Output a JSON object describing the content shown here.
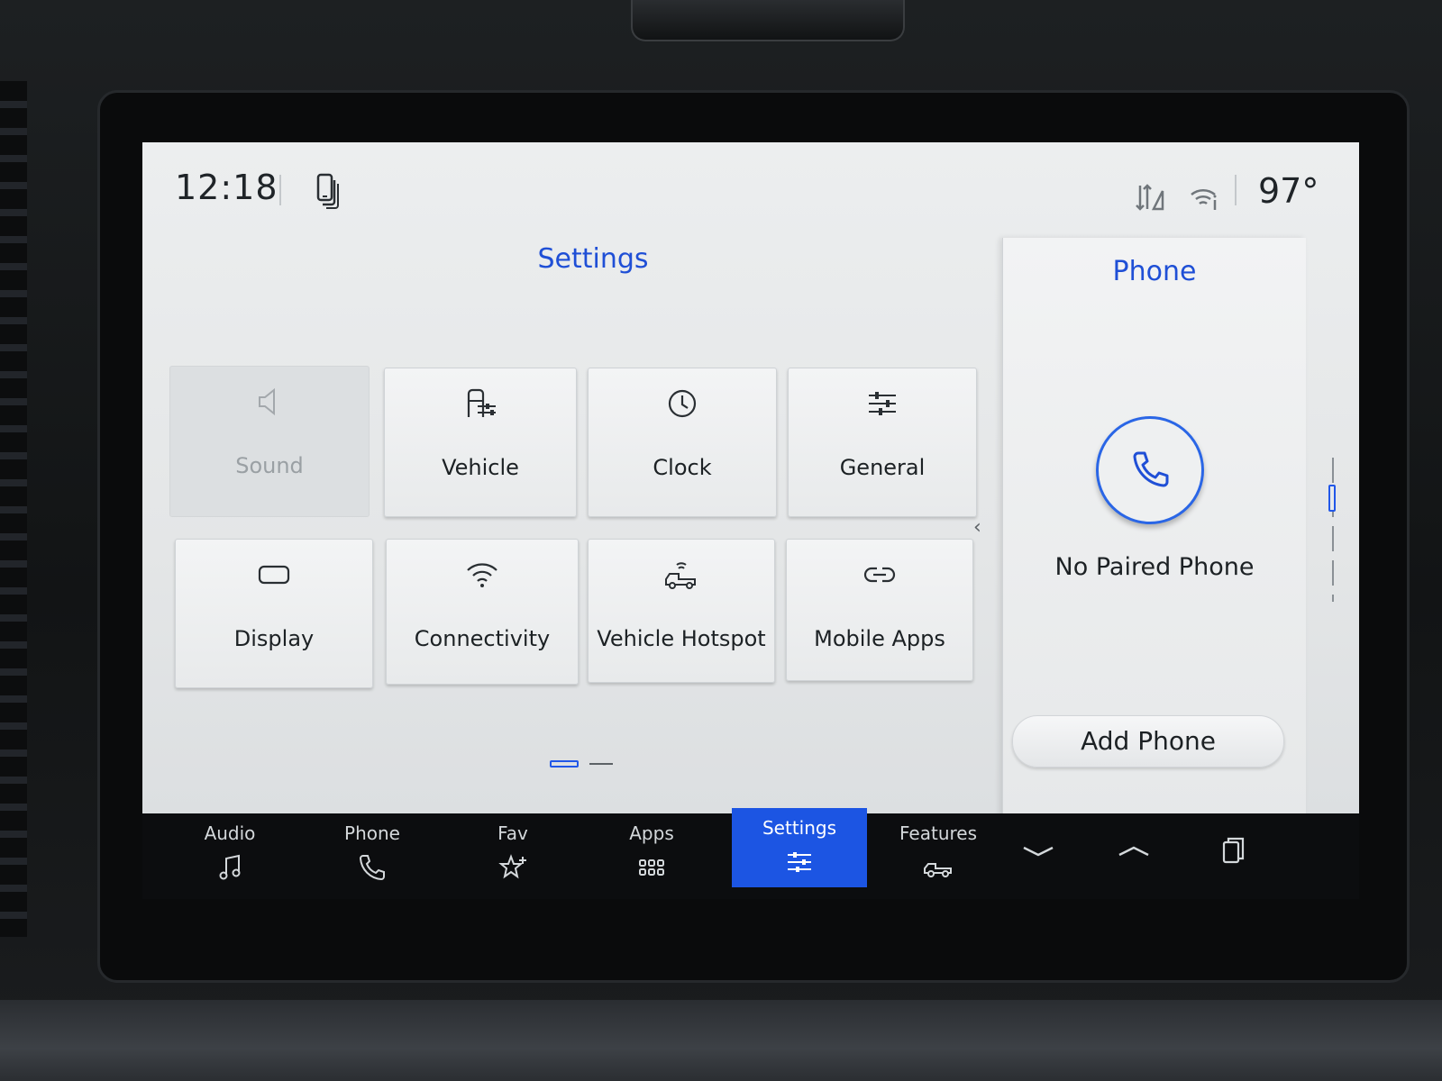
{
  "status": {
    "time": "12:18",
    "temperature": "97°"
  },
  "settings": {
    "title": "Settings",
    "tiles": [
      {
        "label": "Sound",
        "icon": "speaker-icon",
        "enabled": false
      },
      {
        "label": "Vehicle",
        "icon": "vehicle-settings-icon",
        "enabled": true
      },
      {
        "label": "Clock",
        "icon": "clock-icon",
        "enabled": true
      },
      {
        "label": "General",
        "icon": "sliders-icon",
        "enabled": true
      },
      {
        "label": "Display",
        "icon": "display-icon",
        "enabled": true
      },
      {
        "label": "Connectivity",
        "icon": "wifi-icon",
        "enabled": true
      },
      {
        "label": "Vehicle Hotspot",
        "icon": "truck-hotspot-icon",
        "enabled": true
      },
      {
        "label": "Mobile Apps",
        "icon": "link-icon",
        "enabled": true
      }
    ],
    "page_current": 1,
    "page_total": 2
  },
  "phone_panel": {
    "title": "Phone",
    "status_text": "No Paired Phone",
    "add_button_label": "Add Phone"
  },
  "nav": {
    "items": [
      {
        "label": "Audio",
        "icon": "music-note-icon",
        "active": false
      },
      {
        "label": "Phone",
        "icon": "phone-icon",
        "active": false
      },
      {
        "label": "Fav",
        "icon": "star-plus-icon",
        "active": false
      },
      {
        "label": "Apps",
        "icon": "app-grid-icon",
        "active": false
      },
      {
        "label": "Settings",
        "icon": "sliders-icon",
        "active": true
      },
      {
        "label": "Features",
        "icon": "truck-icon",
        "active": false
      }
    ],
    "utility_icons": [
      "chevron-down-icon",
      "chevron-up-icon",
      "multi-window-icon"
    ]
  },
  "colors": {
    "accent": "#1f4fd6",
    "active_tab": "#1c55e3",
    "screen_bg": "#e8eaeb"
  }
}
